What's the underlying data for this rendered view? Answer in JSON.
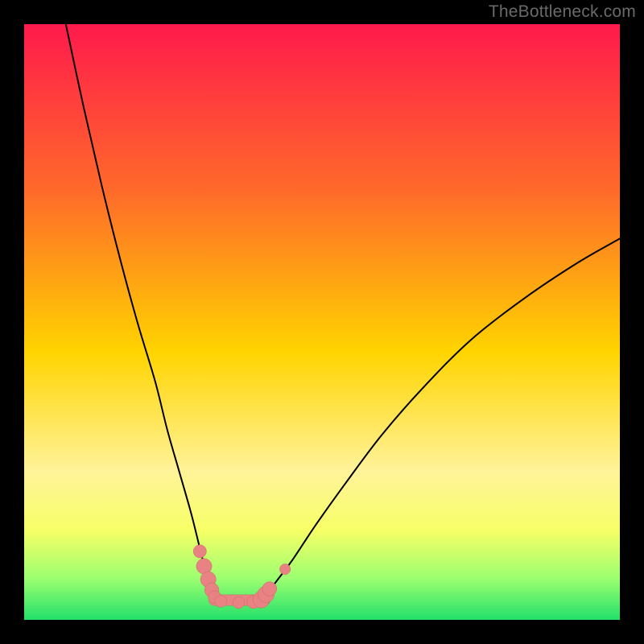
{
  "watermark": "TheBottleneck.com",
  "colors": {
    "frame": "#000000",
    "gradient_top": "#ff1a4c",
    "gradient_mid_upper": "#ff6a2a",
    "gradient_mid": "#ffd400",
    "gradient_mid_lower": "#fff39a",
    "gradient_band": "#f7ff66",
    "gradient_green_light": "#9dff70",
    "gradient_green": "#22e06a",
    "curve": "#000000",
    "marker_fill": "#e98282",
    "marker_stroke": "#c96a6a"
  },
  "chart_data": {
    "type": "line",
    "title": "",
    "xlabel": "",
    "ylabel": "",
    "xlim": [
      0,
      100
    ],
    "ylim": [
      0,
      100
    ],
    "curve_left": {
      "name": "left-branch",
      "x": [
        7,
        10,
        13,
        16,
        19,
        22,
        24,
        26,
        28,
        29.5,
        30.5,
        31.3,
        32
      ],
      "y": [
        100,
        86,
        73,
        61,
        50,
        40,
        32,
        25,
        18,
        12,
        8,
        5,
        3
      ]
    },
    "curve_right": {
      "name": "right-branch",
      "x": [
        40,
        42,
        45,
        49,
        54,
        60,
        67,
        75,
        84,
        93,
        100
      ],
      "y": [
        3,
        6,
        10,
        16,
        23,
        31,
        39,
        47,
        54,
        60,
        64
      ]
    },
    "flat_segment": {
      "name": "trough",
      "x": [
        32,
        40
      ],
      "y": [
        3,
        3
      ]
    },
    "markers": {
      "name": "highlight-points",
      "points": [
        {
          "x": 29.5,
          "y": 11.5,
          "r": 1.1
        },
        {
          "x": 30.2,
          "y": 9.0,
          "r": 1.3
        },
        {
          "x": 30.9,
          "y": 6.8,
          "r": 1.3
        },
        {
          "x": 31.5,
          "y": 5.0,
          "r": 1.2
        },
        {
          "x": 32.0,
          "y": 3.8,
          "r": 1.1
        },
        {
          "x": 33.0,
          "y": 3.1,
          "r": 1.0
        },
        {
          "x": 36.0,
          "y": 2.9,
          "r": 1.0
        },
        {
          "x": 38.5,
          "y": 3.0,
          "r": 1.1
        },
        {
          "x": 39.8,
          "y": 3.4,
          "r": 1.4
        },
        {
          "x": 40.6,
          "y": 4.3,
          "r": 1.4
        },
        {
          "x": 41.2,
          "y": 5.2,
          "r": 1.2
        },
        {
          "x": 43.8,
          "y": 8.5,
          "r": 0.9
        }
      ]
    },
    "trough_bar": {
      "x_start": 31.0,
      "x_end": 41.3,
      "y": 3.3,
      "thickness": 1.8
    }
  }
}
